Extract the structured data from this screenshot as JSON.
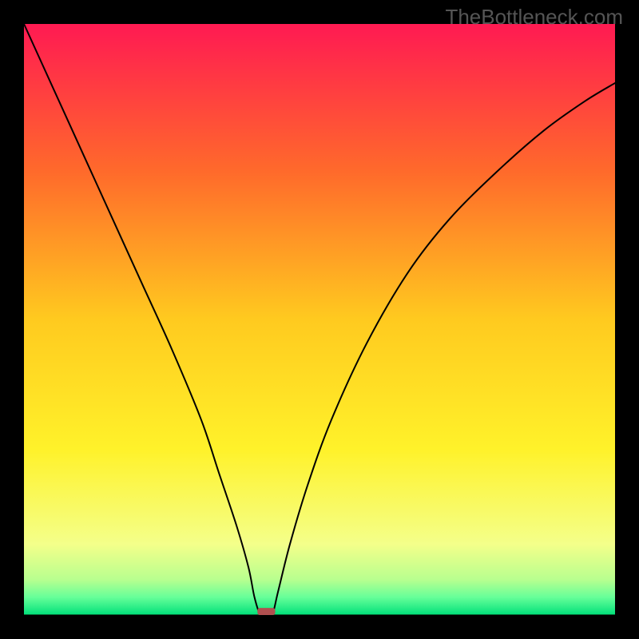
{
  "watermark": "TheBottleneck.com",
  "chart_data": {
    "type": "line",
    "title": "",
    "xlabel": "",
    "ylabel": "",
    "xlim": [
      0,
      100
    ],
    "ylim": [
      0,
      100
    ],
    "background_gradient": {
      "type": "vertical",
      "stops": [
        {
          "offset": 0,
          "color": "#ff1a52"
        },
        {
          "offset": 0.25,
          "color": "#ff6a2b"
        },
        {
          "offset": 0.5,
          "color": "#ffca1f"
        },
        {
          "offset": 0.72,
          "color": "#fff22a"
        },
        {
          "offset": 0.88,
          "color": "#f4ff8a"
        },
        {
          "offset": 0.94,
          "color": "#b8ff8f"
        },
        {
          "offset": 0.97,
          "color": "#66ff99"
        },
        {
          "offset": 1.0,
          "color": "#00e07a"
        }
      ]
    },
    "series": [
      {
        "name": "curve",
        "color": "#000000",
        "stroke_width": 2,
        "x": [
          0,
          5,
          10,
          15,
          20,
          25,
          30,
          33,
          36,
          38,
          39,
          40,
          41,
          42,
          43,
          45,
          48,
          52,
          58,
          65,
          72,
          80,
          88,
          95,
          100
        ],
        "y": [
          100,
          89,
          78,
          67,
          56,
          45,
          33,
          24,
          15,
          8,
          3,
          0,
          0,
          0,
          4,
          12,
          22,
          33,
          46,
          58,
          67,
          75,
          82,
          87,
          90
        ]
      }
    ],
    "marker": {
      "x": 41,
      "y": 0,
      "width": 3,
      "height": 1.2,
      "color": "#b05050",
      "rx": 1
    },
    "baseline": {
      "y": 0,
      "color": "#006633",
      "stroke_width": 2
    }
  }
}
